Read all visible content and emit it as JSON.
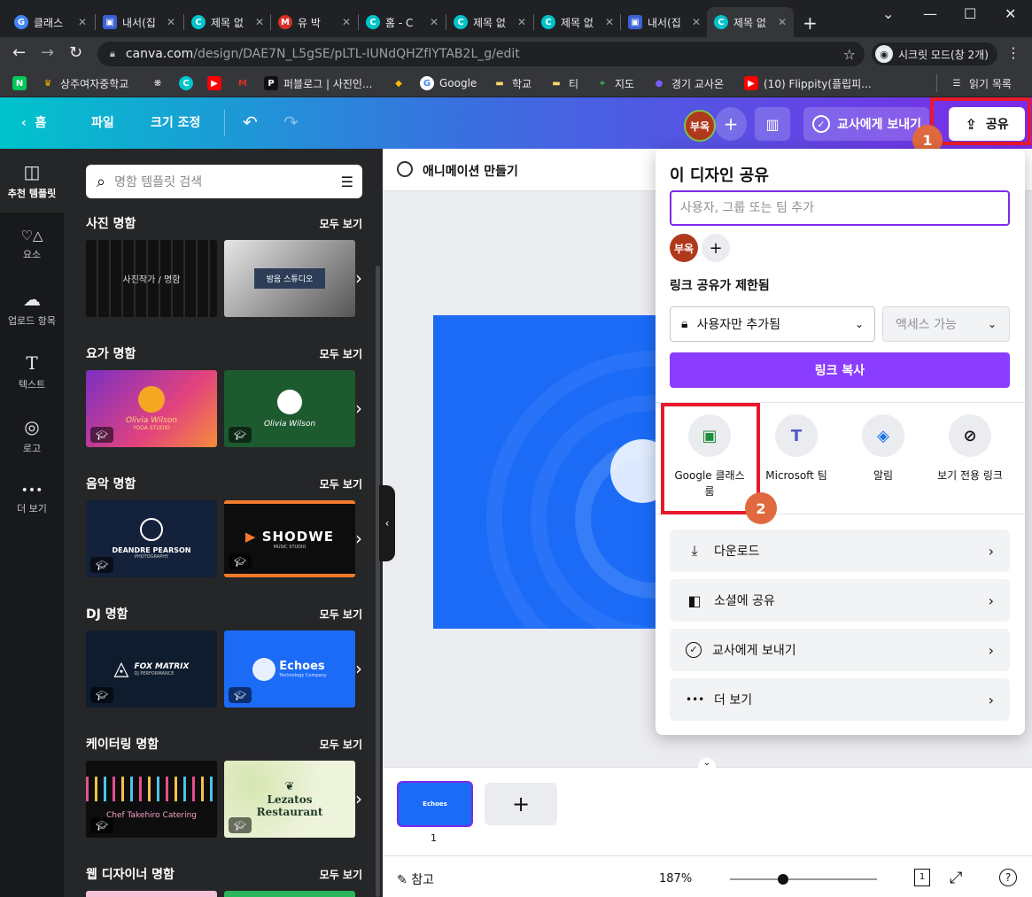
{
  "browser": {
    "tabs": [
      {
        "label": "클래스",
        "fav_color": "#4285f4",
        "fav_char": "G"
      },
      {
        "label": "내서(집",
        "fav_color": "#3b63d6",
        "fav_char": "▣"
      },
      {
        "label": "제목 없",
        "fav_color": "#00c4cc",
        "fav_char": "C"
      },
      {
        "label": "유 박",
        "fav_color": "#d93025",
        "fav_char": "M"
      },
      {
        "label": "홈 - C",
        "fav_color": "#00c4cc",
        "fav_char": "C"
      },
      {
        "label": "제목 없",
        "fav_color": "#00c4cc",
        "fav_char": "C"
      },
      {
        "label": "제목 없",
        "fav_color": "#00c4cc",
        "fav_char": "C"
      },
      {
        "label": "내서(집",
        "fav_color": "#3b63d6",
        "fav_char": "▣"
      },
      {
        "label": "제목 없",
        "fav_color": "#00c4cc",
        "fav_char": "C"
      }
    ],
    "url_host": "canva.com",
    "url_path": "/design/DAE7N_L5gSE/pLTL-IUNdQHZfIYTAB2L_g/edit",
    "incognito_label": "시크릿 모드(창 2개)",
    "bookmarks": [
      {
        "label": "",
        "icon_color": "#03c75a",
        "icon_char": "N"
      },
      {
        "label": "상주여자중학교",
        "icon_color": "#f4b400",
        "icon_char": "♛"
      },
      {
        "label": "",
        "icon_color": "#35363a",
        "icon_char": "⁜"
      },
      {
        "label": "",
        "icon_color": "#00c4cc",
        "icon_char": "C"
      },
      {
        "label": "",
        "icon_color": "#ff0000",
        "icon_char": "▶"
      },
      {
        "label": "",
        "icon_color": "#d93025",
        "icon_char": "M"
      },
      {
        "label": "퍼블로그 | 사진인...",
        "icon_color": "#111111",
        "icon_char": "P"
      },
      {
        "label": "",
        "icon_color": "#fbbc04",
        "icon_char": "◆"
      },
      {
        "label": "Google",
        "icon_color": "#4285f4",
        "icon_char": "G"
      },
      {
        "label": "학교",
        "icon_color": "#f9d56e",
        "icon_char": "▬"
      },
      {
        "label": "티",
        "icon_color": "#f9d56e",
        "icon_char": "▬"
      },
      {
        "label": "지도",
        "icon_color": "#34a853",
        "icon_char": "⌖"
      },
      {
        "label": "경기 교사온",
        "icon_color": "#7a5cff",
        "icon_char": "●"
      },
      {
        "label": "(10) Flippity(플립피...",
        "icon_color": "#ff0000",
        "icon_char": "▶"
      }
    ],
    "reading_list": "읽기 목록"
  },
  "canva_header": {
    "home": "홈",
    "file": "파일",
    "resize": "크기 조정",
    "avatar": "부옥",
    "send_teacher": "교사에게 보내기",
    "share": "공유"
  },
  "left_nav": [
    {
      "label": "추천 템플릿",
      "icon": "template-icon",
      "glyph": "◫"
    },
    {
      "label": "요소",
      "icon": "elements-icon",
      "glyph": "♡△"
    },
    {
      "label": "업로드 항목",
      "icon": "upload-icon",
      "glyph": "☁"
    },
    {
      "label": "텍스트",
      "icon": "text-icon",
      "glyph": "T"
    },
    {
      "label": "로고",
      "icon": "logo-icon",
      "glyph": "◎"
    },
    {
      "label": "더 보기",
      "icon": "more-icon",
      "glyph": "•••"
    }
  ],
  "template_panel": {
    "search_placeholder": "명함 템플릿 검색",
    "see_all": "모두 보기",
    "sections": [
      {
        "title": "사진 명함",
        "thumbs": [
          {
            "bg": "#111111",
            "fg": "#dddddd",
            "text": "사진작가 / 명함",
            "sub": ""
          },
          {
            "bg": "#b9b9b9",
            "fg": "#ffffff",
            "text": "밤음 스튜디오",
            "sub": ""
          }
        ]
      },
      {
        "title": "요가 명함",
        "thumbs": [
          {
            "bg": "#c4318f",
            "fg": "#ffd37a",
            "text": "Olivia Wilson",
            "sub": "YOGA STUDIO"
          },
          {
            "bg": "#1d5b2f",
            "fg": "#ffffff",
            "text": "Olivia Wilson",
            "sub": ""
          }
        ]
      },
      {
        "title": "음악 명함",
        "thumbs": [
          {
            "bg": "#14213a",
            "fg": "#ffffff",
            "text": "DEANDRE PEARSON",
            "sub": "PHOTOGRAPHY"
          },
          {
            "bg": "#0d0d0d",
            "fg": "#ffffff",
            "text": "SHODWE",
            "sub": "MUSIC STUDIO"
          }
        ]
      },
      {
        "title": "DJ 명함",
        "thumbs": [
          {
            "bg": "#0f1c2e",
            "fg": "#ffffff",
            "text": "FOX MATRIX",
            "sub": "DJ PERFORMANCE"
          },
          {
            "bg": "#1b6bf7",
            "fg": "#ffffff",
            "text": "Echoes",
            "sub": "Technology Company"
          }
        ]
      },
      {
        "title": "케이터링 명함",
        "thumbs": [
          {
            "bg": "#0d0d0d",
            "fg": "#f2a0c8",
            "text": "Chef Takehiro Catering",
            "sub": ""
          },
          {
            "bg": "#eef3dc",
            "fg": "#1f3b2a",
            "text": "Lezatos Restaurant",
            "sub": ""
          }
        ]
      },
      {
        "title": "웹 디자이너 명함",
        "thumbs": []
      }
    ]
  },
  "canvas": {
    "animate": "애니메이션 만들기",
    "page_number": "1",
    "page_thumb_text": "Echoes",
    "notes": "참고",
    "zoom": "187%",
    "help": "?"
  },
  "share_panel": {
    "title": "이 디자인 공유",
    "input_placeholder": "사용자, 그룹 또는 팀 추가",
    "avatar": "부옥",
    "link_header": "링크 공유가 제한됨",
    "restrict_option": "사용자만 추가됨",
    "access_option": "액세스 가능",
    "copy_link": "링크 복사",
    "apps": [
      {
        "label": "Google 클래스룸",
        "icon": "google-classroom-icon",
        "color": "#1e8e3e",
        "glyph": "▣"
      },
      {
        "label": "Microsoft 팀",
        "icon": "microsoft-teams-icon",
        "color": "#5059c9",
        "glyph": "T"
      },
      {
        "label": "알림",
        "icon": "notification-icon",
        "color": "#1a73e8",
        "glyph": "◈"
      },
      {
        "label": "보기 전용 링크",
        "icon": "link-icon",
        "color": "#111111",
        "glyph": "⊘"
      }
    ],
    "rows": [
      {
        "label": "다운로드",
        "icon": "download-icon",
        "glyph": "⤓"
      },
      {
        "label": "소셜에 공유",
        "icon": "social-share-icon",
        "glyph": "◧"
      },
      {
        "label": "교사에게 보내기",
        "icon": "send-teacher-icon",
        "glyph": "✓"
      },
      {
        "label": "더 보기",
        "icon": "more-icon",
        "glyph": "•••"
      }
    ]
  },
  "annotations": {
    "step1": "1",
    "step2": "2",
    "highlight_color": "#e8192c",
    "badge_color": "#e0693f"
  }
}
